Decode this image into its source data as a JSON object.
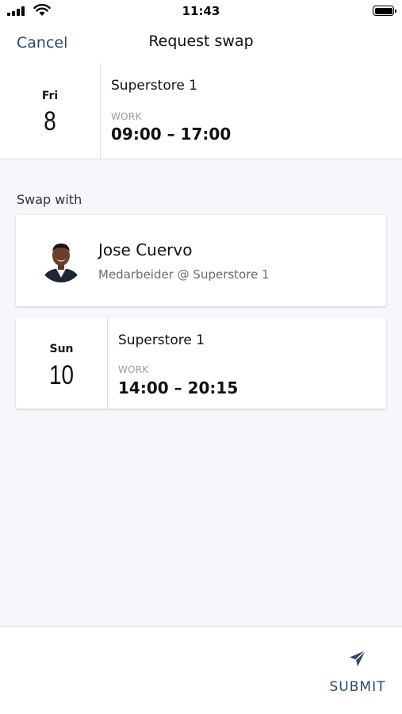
{
  "status_bar": {
    "time": "11:43"
  },
  "nav": {
    "cancel_label": "Cancel",
    "title": "Request swap"
  },
  "own_shift": {
    "day_of_week": "Fri",
    "day": "8",
    "store": "Superstore 1",
    "type": "WORK",
    "hours": "09:00 – 17:00"
  },
  "swap_section": {
    "label": "Swap with"
  },
  "colleague": {
    "name": "Jose Cuervo",
    "role": "Medarbeider @ Superstore 1"
  },
  "colleague_shift": {
    "day_of_week": "Sun",
    "day": "10",
    "store": "Superstore 1",
    "type": "WORK",
    "hours": "14:00 – 20:15"
  },
  "actions": {
    "submit_label": "SUBMIT"
  },
  "colors": {
    "accent": "#2b4a6b",
    "background": "#f6f6fb"
  },
  "icons": {
    "submit": "send-icon",
    "signal": "signal-icon",
    "wifi": "wifi-icon",
    "battery": "battery-icon"
  }
}
